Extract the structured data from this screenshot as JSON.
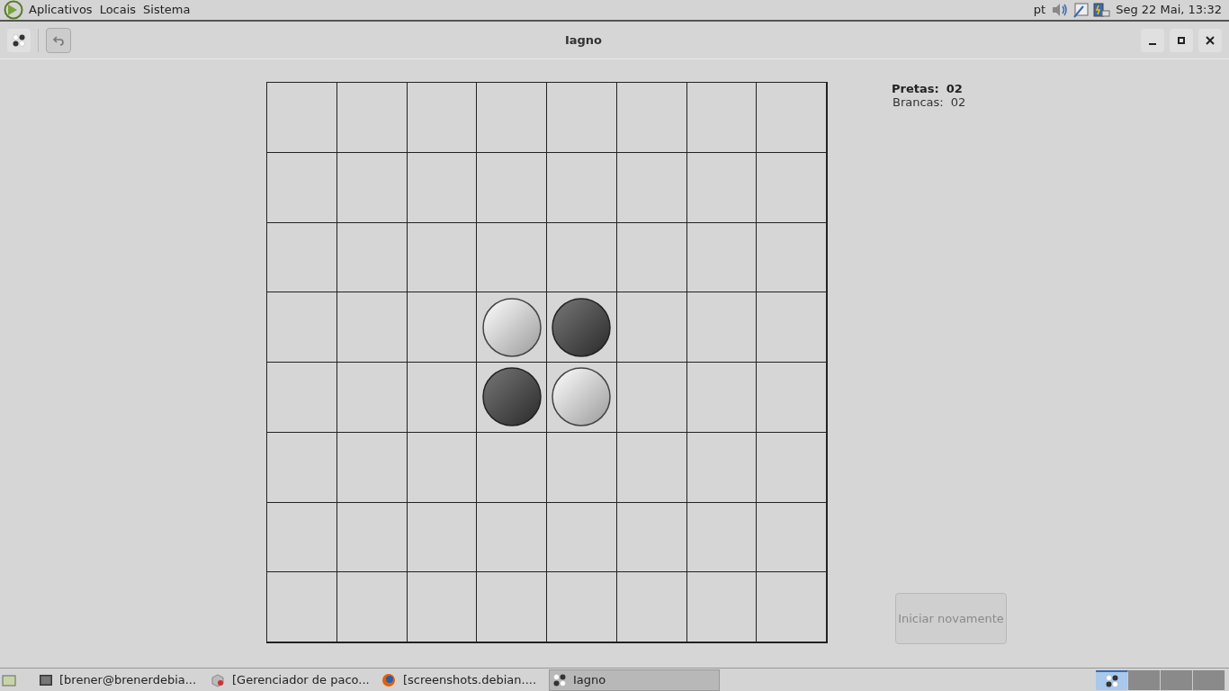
{
  "top_panel": {
    "menus": [
      "Aplicativos",
      "Locais",
      "Sistema"
    ],
    "language": "pt",
    "clock": "Seg 22 Mai, 13:32"
  },
  "window": {
    "title": "Iagno"
  },
  "board": {
    "rows": [
      [
        {
          "kind": "empty"
        },
        {
          "kind": "empty"
        },
        {
          "kind": "empty"
        },
        {
          "kind": "empty"
        },
        {
          "kind": "empty"
        },
        {
          "kind": "empty"
        },
        {
          "kind": "empty"
        },
        {
          "kind": "empty"
        }
      ],
      [
        {
          "kind": "empty"
        },
        {
          "kind": "empty"
        },
        {
          "kind": "empty"
        },
        {
          "kind": "empty"
        },
        {
          "kind": "empty"
        },
        {
          "kind": "empty"
        },
        {
          "kind": "empty"
        },
        {
          "kind": "empty"
        }
      ],
      [
        {
          "kind": "empty"
        },
        {
          "kind": "empty"
        },
        {
          "kind": "empty"
        },
        {
          "kind": "empty"
        },
        {
          "kind": "empty"
        },
        {
          "kind": "empty"
        },
        {
          "kind": "empty"
        },
        {
          "kind": "empty"
        }
      ],
      [
        {
          "kind": "empty"
        },
        {
          "kind": "empty"
        },
        {
          "kind": "empty"
        },
        {
          "kind": "white"
        },
        {
          "kind": "black"
        },
        {
          "kind": "empty"
        },
        {
          "kind": "empty"
        },
        {
          "kind": "empty"
        }
      ],
      [
        {
          "kind": "empty"
        },
        {
          "kind": "empty"
        },
        {
          "kind": "empty"
        },
        {
          "kind": "black"
        },
        {
          "kind": "white"
        },
        {
          "kind": "empty"
        },
        {
          "kind": "empty"
        },
        {
          "kind": "empty"
        }
      ],
      [
        {
          "kind": "empty"
        },
        {
          "kind": "empty"
        },
        {
          "kind": "empty"
        },
        {
          "kind": "empty"
        },
        {
          "kind": "empty"
        },
        {
          "kind": "empty"
        },
        {
          "kind": "empty"
        },
        {
          "kind": "empty"
        }
      ],
      [
        {
          "kind": "empty"
        },
        {
          "kind": "empty"
        },
        {
          "kind": "empty"
        },
        {
          "kind": "empty"
        },
        {
          "kind": "empty"
        },
        {
          "kind": "empty"
        },
        {
          "kind": "empty"
        },
        {
          "kind": "empty"
        }
      ],
      [
        {
          "kind": "empty"
        },
        {
          "kind": "empty"
        },
        {
          "kind": "empty"
        },
        {
          "kind": "empty"
        },
        {
          "kind": "empty"
        },
        {
          "kind": "empty"
        },
        {
          "kind": "empty"
        },
        {
          "kind": "empty"
        }
      ]
    ]
  },
  "scores": [
    {
      "label": "Pretas:",
      "value": "02",
      "current": true
    },
    {
      "label": "Brancas:",
      "value": "02",
      "current": false
    }
  ],
  "restart_button": {
    "label": "Iniciar novamente",
    "disabled": true
  },
  "taskbar": {
    "tasks": [
      {
        "kind": "terminal",
        "label": "[brener@brenerdebia...",
        "selected": false
      },
      {
        "kind": "package",
        "label": "[Gerenciador de paco...",
        "selected": false
      },
      {
        "kind": "browser",
        "label": "[screenshots.debian....",
        "selected": false
      },
      {
        "kind": "game",
        "label": "Iagno",
        "selected": true
      }
    ],
    "workspaces": [
      {
        "selected": true
      },
      {
        "selected": false
      },
      {
        "selected": false
      },
      {
        "selected": false
      }
    ]
  }
}
